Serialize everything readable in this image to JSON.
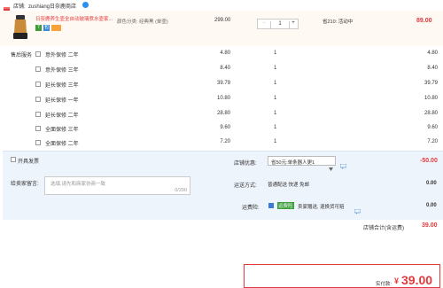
{
  "store": {
    "label": "店铺:",
    "name": "zushiang日奈鹿商店"
  },
  "product": {
    "title": "日奈鹿养生壶全自动玻璃煮水壶家...",
    "color_label": "颜色分类: 经典黑 (单壶)",
    "price": "299.00",
    "quantity": "1",
    "promo": "省210: 活动中",
    "subtotal": "89.00",
    "badges": [
      "7",
      "包"
    ]
  },
  "services_label": "售后服务",
  "services": [
    {
      "name": "意外保修 二年",
      "price": "4.80",
      "qty": "1",
      "subtotal": "4.80"
    },
    {
      "name": "意外保修 三年",
      "price": "8.40",
      "qty": "1",
      "subtotal": "8.40"
    },
    {
      "name": "延长保修 三年",
      "price": "39.79",
      "qty": "1",
      "subtotal": "39.79"
    },
    {
      "name": "延长保修 一年",
      "price": "10.80",
      "qty": "1",
      "subtotal": "10.80"
    },
    {
      "name": "延长保修 二年",
      "price": "28.80",
      "qty": "1",
      "subtotal": "28.80"
    },
    {
      "name": "全面保修 三年",
      "price": "9.60",
      "qty": "1",
      "subtotal": "9.60"
    },
    {
      "name": "全面保修 二年",
      "price": "7.20",
      "qty": "1",
      "subtotal": "7.20"
    }
  ],
  "invoice_label": "开具发票",
  "store_discount": {
    "label": "店铺优惠:",
    "value": "省50元:单条器人更1",
    "amount": "-50.00"
  },
  "message": {
    "label": "给卖家留言:",
    "placeholder": "选填,请先和商家协商一致",
    "count": "0/200"
  },
  "shipping": {
    "label": "运送方式:",
    "value": "普通配送 快递 免邮",
    "amount": "0.00"
  },
  "freight_ins": {
    "label": "运费险:",
    "tag": "运费险",
    "text": "卖家赠送, 退换货可赔",
    "amount": "0.00"
  },
  "store_total": {
    "label": "店铺合计(含运费)",
    "amount": "39.00"
  },
  "pay_total": {
    "label": "实付款:",
    "symbol": "¥",
    "amount": "39.00"
  },
  "colors": {
    "accent": "#e4393c",
    "section_bg": "#eef4fc",
    "tag_green": "#3c9d3c"
  },
  "icons": [
    "store-icon",
    "badge-icon",
    "speech-icon",
    "chevron-down-icon"
  ]
}
